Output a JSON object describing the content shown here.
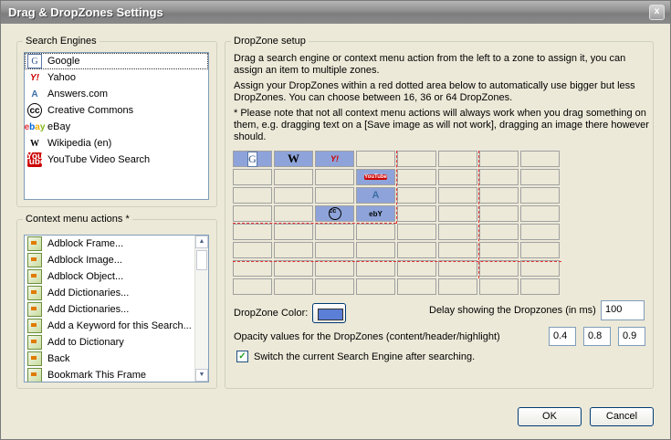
{
  "window": {
    "title": "Drag & DropZones Settings",
    "close_glyph": "x"
  },
  "search_engines": {
    "legend": "Search Engines",
    "items": [
      {
        "label": "Google",
        "icon": "google-icon"
      },
      {
        "label": "Yahoo",
        "icon": "yahoo-icon"
      },
      {
        "label": "Answers.com",
        "icon": "answers-icon"
      },
      {
        "label": "Creative Commons",
        "icon": "creative-commons-icon"
      },
      {
        "label": "eBay",
        "icon": "ebay-icon"
      },
      {
        "label": "Wikipedia (en)",
        "icon": "wikipedia-icon"
      },
      {
        "label": "YouTube Video Search",
        "icon": "youtube-icon"
      }
    ]
  },
  "context_actions": {
    "legend": "Context menu actions *",
    "items": [
      "Adblock Frame...",
      "Adblock Image...",
      "Adblock Object...",
      "Add Dictionaries...",
      "Add Dictionaries...",
      "Add a Keyword for this Search...",
      "Add to Dictionary",
      "Back",
      "Bookmark This Frame"
    ]
  },
  "dropzone": {
    "legend": "DropZone setup",
    "desc1": "Drag a search engine or context menu action from the left to a zone to assign it, you can assign an item to multiple zones.",
    "desc2": "Assign your DropZones within a red dotted area below to automatically use bigger but less DropZones. You can choose between 16, 36 or 64 DropZones.",
    "desc3": "* Please note that not all context menu actions will always work when you drag something on them, e.g. dragging text on a [Save image as will not work], dragging an image there however should.",
    "zone_icons": {
      "google": "G",
      "wiki": "W",
      "yahoo": "Y!",
      "youtube_top": "You",
      "youtube_bottom": "Tube",
      "answers": "A",
      "cc": "cc",
      "ebay": "ebY"
    },
    "color_label": "DropZone Color:",
    "color_value": "#5b7fd6",
    "delay_label": "Delay showing the Dropzones (in ms)",
    "delay_value": "100",
    "opacity_label": "Opacity values for the DropZones (content/header/highlight)",
    "opacity_values": [
      "0.4",
      "0.8",
      "0.9"
    ],
    "switch_label": "Switch the current Search Engine after searching.",
    "switch_checked": true
  },
  "buttons": {
    "ok": "OK",
    "cancel": "Cancel"
  }
}
